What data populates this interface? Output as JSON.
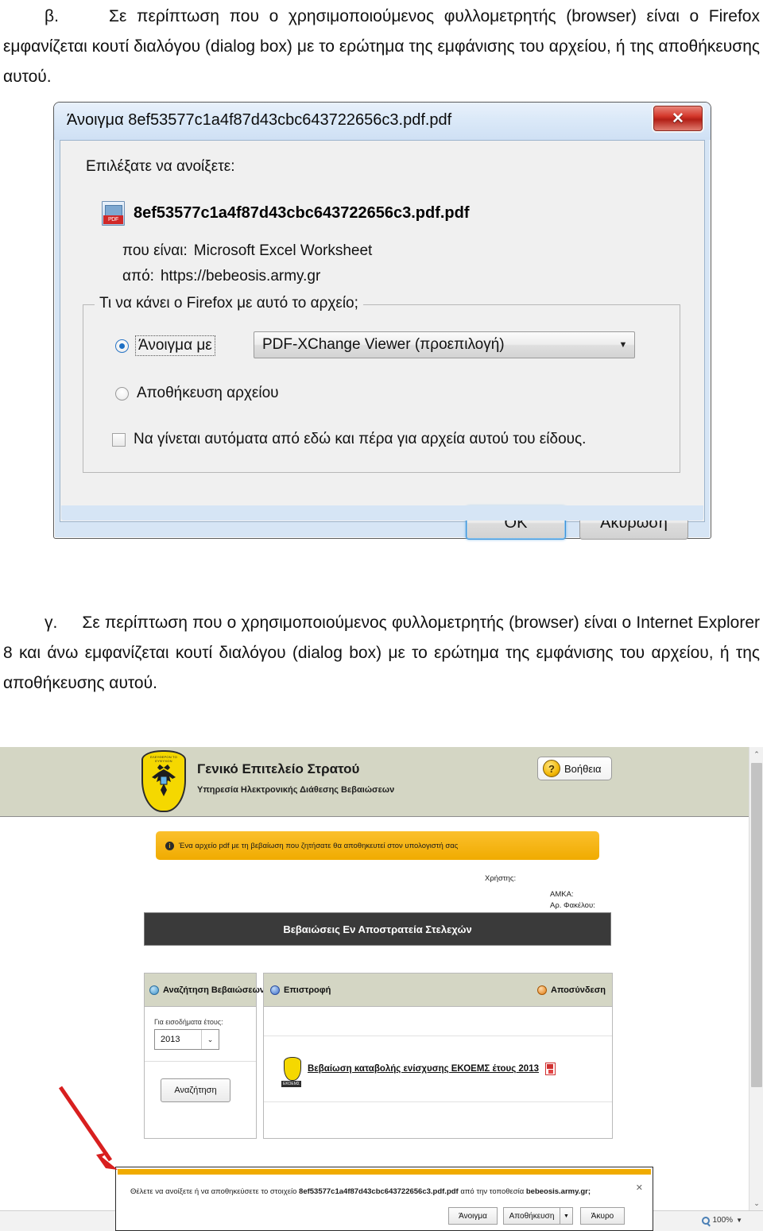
{
  "document": {
    "paragraph_beta": {
      "marker": "β.",
      "text": "Σε περίπτωση που ο χρησιμοποιούμενος φυλλομετρητής (browser) είναι ο Firefox εμφανίζεται κουτί διαλόγου (dialog box) με το ερώτημα της εμφάνισης του αρχείου, ή της αποθήκευσης αυτού."
    },
    "paragraph_gamma": {
      "marker": "γ.",
      "text": "Σε περίπτωση που ο χρησιμοποιούμενος φυλλομετρητής (browser) είναι ο Internet Explorer 8 και άνω εμφανίζεται κουτί διαλόγου (dialog box) με το ερώτημα της εμφάνισης του αρχείου, ή της αποθήκευσης αυτού."
    }
  },
  "firefox_dialog": {
    "title": "Άνοιγμα 8ef53577c1a4f87d43cbc643722656c3.pdf.pdf",
    "close_glyph": "✕",
    "lead_text": "Επιλέξατε να ανοίξετε:",
    "file_name": "8ef53577c1a4f87d43cbc643722656c3.pdf.pdf",
    "file_icon": "pdf-file-icon",
    "type_label": "που είναι:",
    "type_value": "Microsoft Excel Worksheet",
    "from_label": "από:",
    "from_value": "https://bebeosis.army.gr",
    "fieldset_legend": "Τι να κάνει ο Firefox  με αυτό το αρχείο;",
    "option_open_label": "Άνοιγμα με",
    "option_open_selected": true,
    "app_select_value": "PDF-XChange Viewer (προεπιλογή)",
    "app_select_arrow": "▼",
    "option_save_label": "Αποθήκευση αρχείου",
    "option_save_selected": false,
    "checkbox_auto_label": "Να γίνεται αυτόματα από εδώ και πέρα για αρχεία αυτού του είδους.",
    "checkbox_auto_checked": false,
    "ok_label": "OK",
    "cancel_label": "Ακύρωση"
  },
  "ie_page": {
    "header": {
      "org_title": "Γενικό Επιτελείο Στρατού",
      "org_subtitle": "Υπηρεσία Ηλεκτρονικής Διάθεσης Βεβαιώσεων",
      "shield_motto": "ΕΛΕΥΘΕΡΟΝ ΤΟ ΕΥΨΥΧΟΝ",
      "help_label": "Βοήθεια",
      "help_icon": "help-headset-icon"
    },
    "notice": {
      "icon": "info-icon",
      "text": "Ένα αρχείο pdf με τη βεβαίωση που ζητήσατε θα αποθηκευτεί στον υπολογιστή σας"
    },
    "user_info": {
      "user_label": "Χρήστης:",
      "amka_label": "ΑΜΚΑ:",
      "folder_label": "Αρ. Φακέλου:"
    },
    "section_title": "Βεβαιώσεις Εν Αποστρατεία Στελεχών",
    "left_panel": {
      "head_label": "Αναζήτηση Βεβαιώσεων",
      "head_icon": "search-certificates-icon",
      "year_label": "Για εισοδήματα έτους:",
      "year_value": "2013",
      "year_arrow": "⌄",
      "search_button": "Αναζήτηση"
    },
    "right_panel": {
      "back_label": "Επιστροφή",
      "back_icon": "back-arrow-icon",
      "logout_label": "Αποσύνδεση",
      "logout_icon": "power-logout-icon",
      "cert_link": "Βεβαίωση καταβολής ενίσχυσης ΕΚΟΕΜΣ έτους 2013",
      "cert_logo_tag": "ΕΚΟΕΜΣ",
      "cert_pdf_icon": "pdf-icon"
    },
    "download_bar": {
      "message_prefix": "Θέλετε να ανοίξετε ή να αποθηκεύσετε το στοιχείο",
      "file_name": "8ef53577c1a4f87d43cbc643722656c3.pdf.pdf",
      "message_middle": "από την τοποθεσία",
      "site": "bebeosis.army.gr;",
      "open_label": "Άνοιγμα",
      "save_label": "Αποθήκευση",
      "save_arrow": "▼",
      "cancel_label": "Άκυρο",
      "close_glyph": "✕"
    },
    "status_bar": {
      "zoom_value": "100%",
      "zoom_caret": "▼",
      "zoom_icon": "magnifier-icon"
    },
    "scrollbar": {
      "up_glyph": "⌃",
      "down_glyph": "⌄"
    }
  },
  "annotation": {
    "arrow_color": "#d81f1f",
    "arrow_name": "red-pointer-arrow"
  }
}
